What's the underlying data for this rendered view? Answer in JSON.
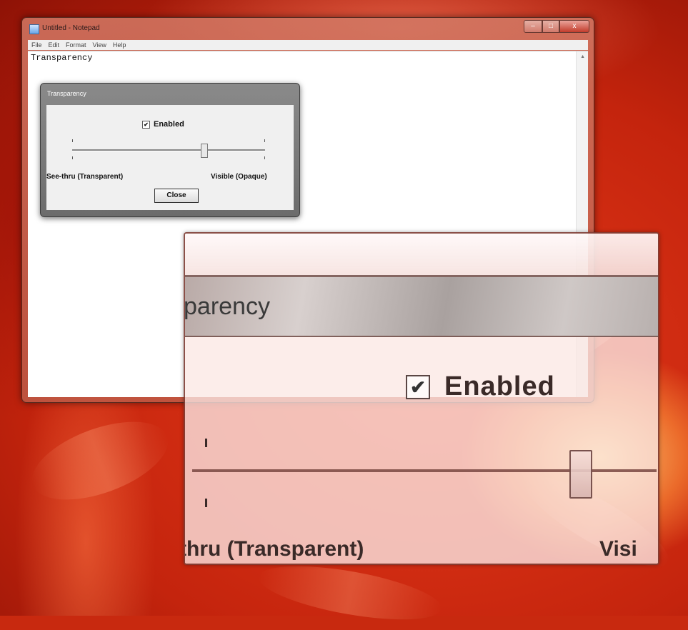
{
  "notepad": {
    "title": "Untitled - Notepad",
    "menu": [
      "File",
      "Edit",
      "Format",
      "View",
      "Help"
    ],
    "content": "Transparency",
    "controls": {
      "minimize": "–",
      "maximize": "□",
      "close": "x"
    }
  },
  "dialog": {
    "title": "Transparency",
    "checkbox_label": "Enabled",
    "checkbox_checked": true,
    "slider_value": 0.8,
    "label_left": "See-thru (Transparent)",
    "label_right": "Visible (Opaque)",
    "close_label": "Close"
  },
  "magnifier": {
    "title_fragment": "parency",
    "checkbox_label": "Enabled",
    "label_left_fragment": "thru (Transparent)",
    "label_right_fragment": "Visi"
  },
  "glyphs": {
    "check": "✔",
    "scroll_up": "▲"
  }
}
